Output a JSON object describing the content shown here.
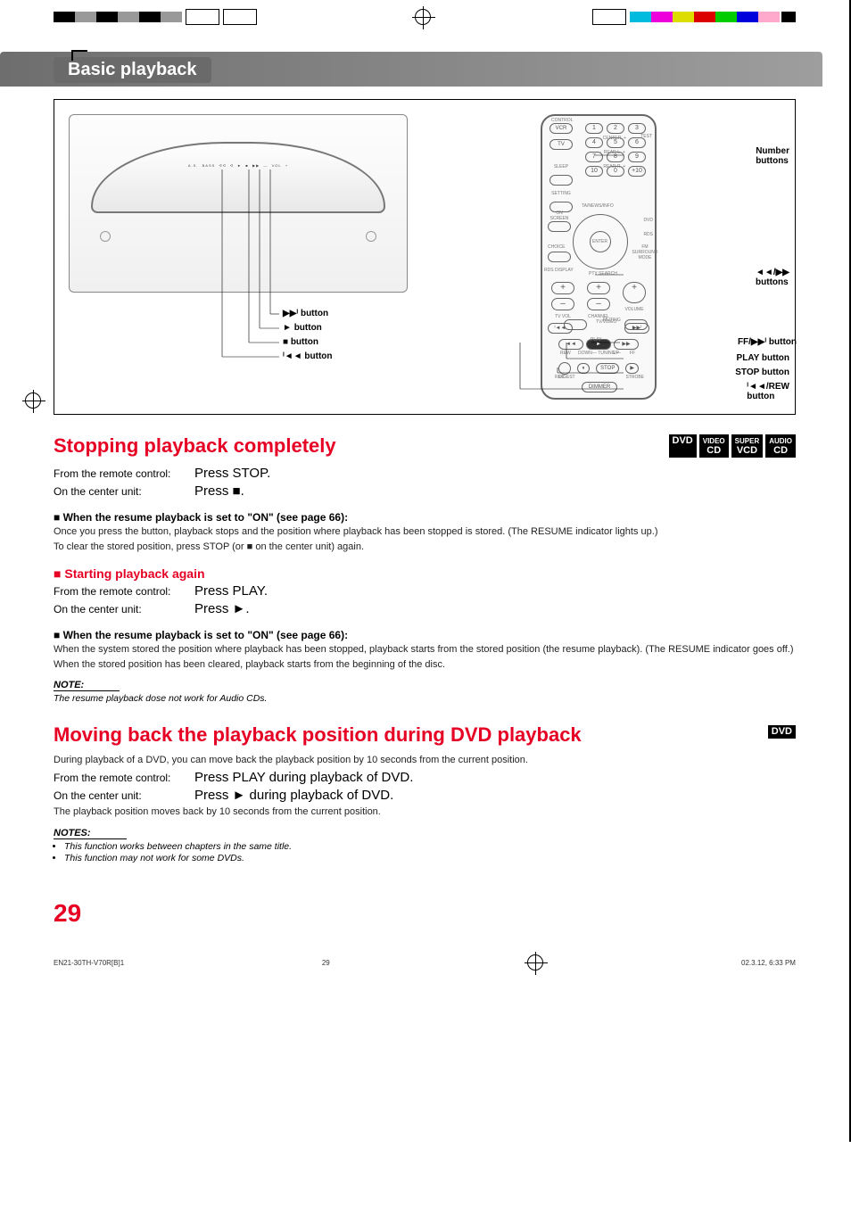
{
  "banner": {
    "title": "Basic playback"
  },
  "unit_callouts": {
    "btn1": "᐀ button",
    "btn2": "► button",
    "btn3": "■ button",
    "btn4": "ᐊᐊ button"
  },
  "remote_labels": {
    "control": "CONTROL",
    "vcr": "VCR",
    "tv": "TV",
    "sleep": "SLEEP",
    "setting": "SETTING",
    "center": "CENTER",
    "rear_l": "REAR·L",
    "rear_r": "REAR·R",
    "test": "TEST",
    "on_screen": "ON SCREEN",
    "rds_display": "RDS DISPLAY",
    "choice": "CHOICE",
    "ta_news": "TA/NEWS/INFO",
    "pty": "PTY SEARCH",
    "dvd": "DVD",
    "rds": "RDS",
    "fm_surround": "FM SURROUND MODE",
    "enter": "ENTER",
    "tv_vol": "TV VOL",
    "channel": "CHANNEL",
    "volume": "VOLUME",
    "tv_video": "TV/VIDEO",
    "muting": "MUTING",
    "rew": "REW",
    "play": "PLAY",
    "ff": "FF",
    "tuning": "TUNING",
    "down": "DOWN",
    "up": "UP",
    "rec": "REC",
    "stop": "STOP",
    "strobe": "STROBE",
    "digest": "DIGEST",
    "dimmer": "DIMMER"
  },
  "remote_callouts": {
    "number": "Number buttons",
    "skip": "ᐊᐊ/▶▶ buttons",
    "ff": "FF/▶▶ button",
    "play": "PLAY button",
    "stop": "STOP button",
    "rew": "ᐊᐊ/REW button"
  },
  "section1": {
    "title": "Stopping playback completely",
    "chips": [
      {
        "top": "",
        "bot": "DVD"
      },
      {
        "top": "VIDEO",
        "bot": "CD"
      },
      {
        "top": "SUPER",
        "bot": "VCD"
      },
      {
        "top": "AUDIO",
        "bot": "CD"
      }
    ],
    "p1_label": "From the remote control:",
    "p1_val": "Press STOP.",
    "p2_label": "On the center unit:",
    "p2_val": "Press ■.",
    "sub1": "When the resume playback is set to \"ON\" (see page 66):",
    "body1a": "Once you press the button, playback stops and the position where playback has been stopped is stored. (The RESUME indicator lights up.)",
    "body1b": "To clear the stored position, press STOP (or ■ on the center unit) again.",
    "sub2": "Starting playback again",
    "p3_label": "From the remote control:",
    "p3_val": "Press PLAY.",
    "p4_label": "On the center unit:",
    "p4_val": "Press ►.",
    "sub3": "When the resume playback is set to \"ON\" (see page 66):",
    "body2a": "When the system stored the position where playback has been stopped, playback starts from the stored position (the resume playback). (The RESUME indicator goes off.)",
    "body2b": "When the stored position has been cleared, playback starts from the beginning of the disc.",
    "note_label": "NOTE:",
    "note_text": "The resume playback dose not work for Audio CDs."
  },
  "section2": {
    "title": "Moving back the playback position during DVD playback",
    "chips": [
      {
        "top": "",
        "bot": "DVD"
      }
    ],
    "intro": "During playback of a DVD, you can move back the playback position by 10 seconds from the current position.",
    "p1_label": "From the remote control:",
    "p1_val": "Press PLAY during playback of DVD.",
    "p2_label": "On the center unit:",
    "p2_val": "Press ► during playback of DVD.",
    "body1": "The playback position moves back by 10 seconds from the current position.",
    "notes_label": "NOTES:",
    "note1": "This function works between chapters in the same title.",
    "note2": "This function may not work for some DVDs."
  },
  "page_number": "29",
  "footer": {
    "left": "EN21-30TH-V70R[B]1",
    "mid": "29",
    "right": "02.3.12, 6:33 PM"
  }
}
